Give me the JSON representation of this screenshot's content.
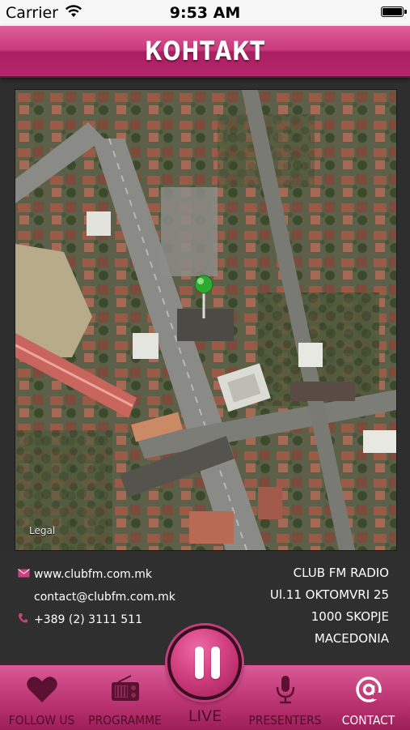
{
  "status_bar": {
    "carrier": "Carrier",
    "time": "9:53 AM",
    "battery_level": 1.0
  },
  "header": {
    "title": "КОНТАКТ"
  },
  "map": {
    "legal_label": "Legal",
    "pin_color": "#2fa82f"
  },
  "contact": {
    "website": "www.clubfm.com.mk",
    "email": "contact@clubfm.com.mk",
    "phone": "+389 (2) 3111 511",
    "icons": [
      "envelope-icon",
      "phone-icon"
    ],
    "address": {
      "name": "CLUB FM RADIO",
      "street": "Ul.11 OKTOMVRI 25",
      "city": "1000 SKOPJE",
      "country": "MACEDONIA"
    }
  },
  "tabs": {
    "follow_us": "FOLLOW US",
    "programme": "PROGRAMME",
    "live": "LIVE",
    "presenters": "PRESENTERS",
    "contact": "CONTACT",
    "active": "contact"
  },
  "colors": {
    "accent": "#c83a7c",
    "tab_text": "#4a0f2a",
    "active_tab_text": "#ffffff"
  }
}
